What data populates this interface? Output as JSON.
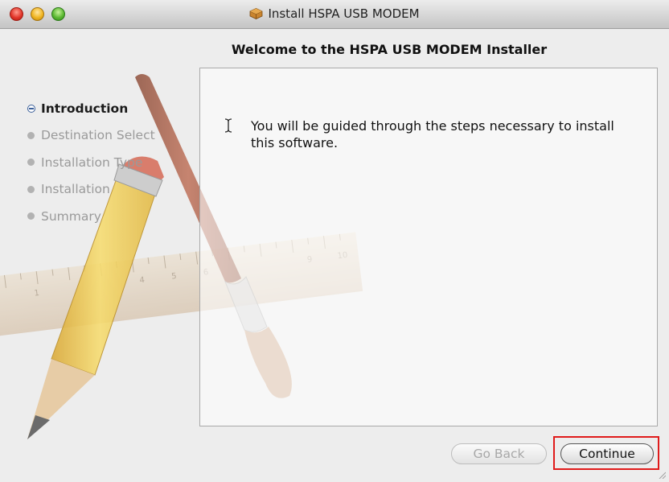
{
  "window": {
    "title": "Install HSPA USB MODEM"
  },
  "heading": "Welcome to the HSPA USB MODEM Installer",
  "steps": [
    {
      "label": "Introduction",
      "state": "current"
    },
    {
      "label": "Destination Select",
      "state": "pending"
    },
    {
      "label": "Installation Type",
      "state": "pending"
    },
    {
      "label": "Installation",
      "state": "pending"
    },
    {
      "label": "Summary",
      "state": "pending"
    }
  ],
  "content": {
    "message": "You will be guided through the steps necessary to install this software."
  },
  "buttons": {
    "go_back": "Go Back",
    "continue": "Continue"
  },
  "icons": {
    "window_controls": [
      "close-icon",
      "minimize-icon",
      "zoom-icon"
    ],
    "title_icon": "package-icon",
    "text_cursor": "ibeam-cursor-icon"
  },
  "colors": {
    "close": "#e2372b",
    "minimize": "#f0b522",
    "zoom": "#5cb833",
    "highlight": "#e01b1b",
    "step_active": "#1a1a1a",
    "step_pending": "#9a9a9a"
  }
}
